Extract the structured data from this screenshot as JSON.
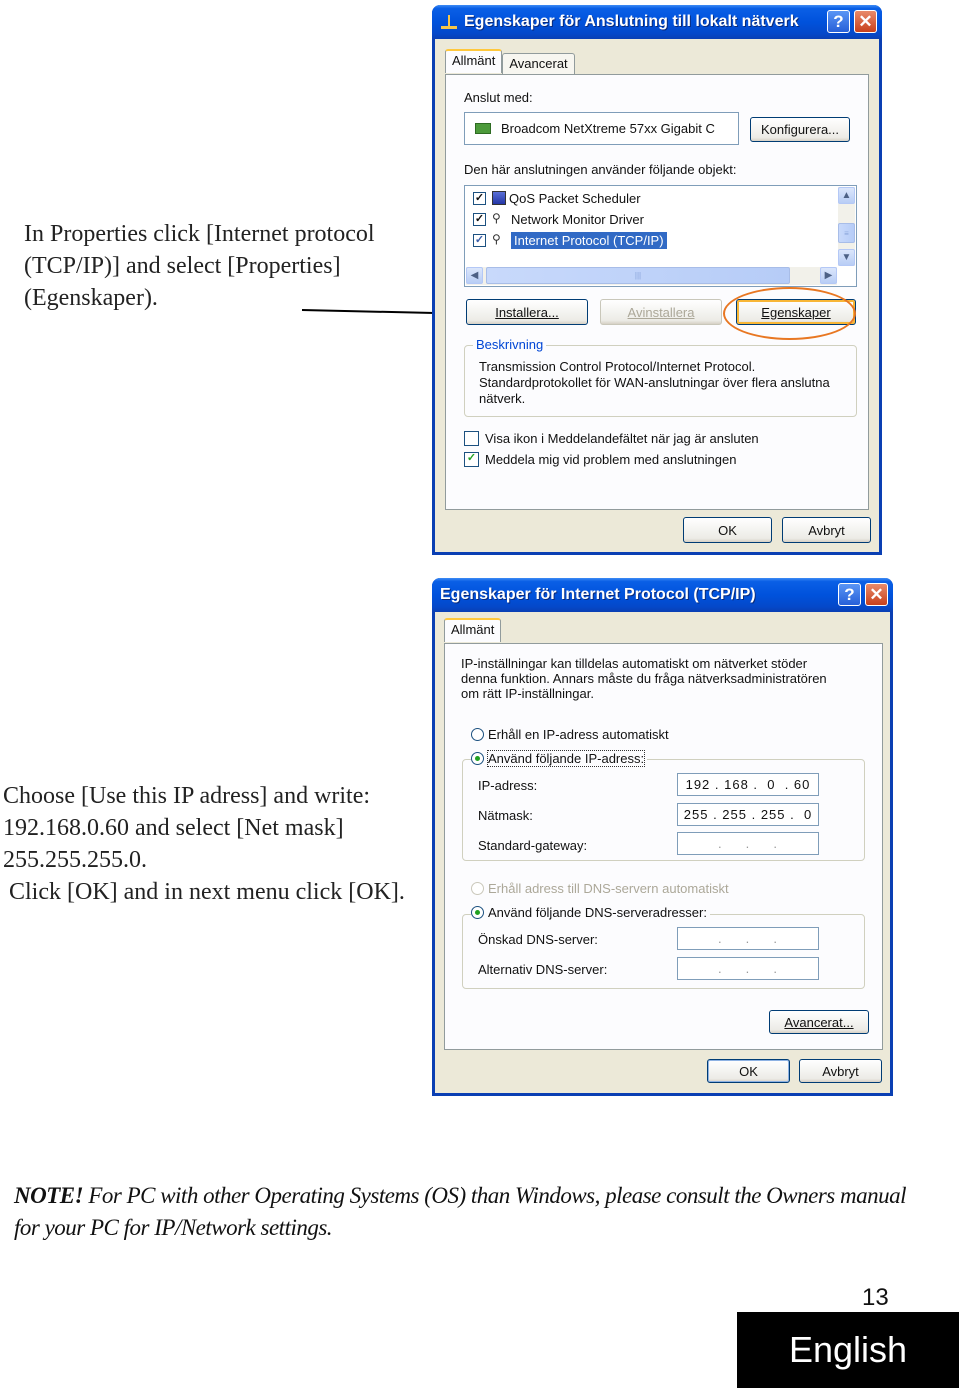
{
  "instructions": {
    "step1": "In Properties click [Internet protocol (TCP/IP)] and select [Properties] (Egenskaper).",
    "step2_line1": "Choose [Use this IP adress] and write: 192.168.0.60 and select [Net mask] 255.255.255.0.",
    "step2_line2": " Click [OK] and in next menu click [OK]."
  },
  "dialog1": {
    "title": "Egenskaper för Anslutning till lokalt nätverk",
    "tabs": [
      "Allmänt",
      "Avancerat"
    ],
    "connect_with_label": "Anslut med:",
    "adapter_name": "Broadcom NetXtreme 57xx Gigabit C",
    "configure_button": "Konfigurera...",
    "components_label": "Den här anslutningen använder följande objekt:",
    "components": [
      {
        "label": "QoS Packet Scheduler",
        "checked": true,
        "icon": "scheduler-icon"
      },
      {
        "label": "Network Monitor Driver",
        "checked": true,
        "icon": "network-protocol-icon"
      },
      {
        "label": "Internet Protocol (TCP/IP)",
        "checked": true,
        "selected": true,
        "icon": "network-protocol-icon"
      }
    ],
    "install_button": "Installera...",
    "uninstall_button": "Avinstallera",
    "properties_button": "Egenskaper",
    "description_group": "Beskrivning",
    "description_text": "Transmission Control Protocol/Internet Protocol. Standardprotokollet för WAN-anslutningar över flera anslutna nätverk.",
    "show_icon_label": "Visa ikon i Meddelandefältet när jag är ansluten",
    "show_icon_checked": false,
    "notify_label": "Meddela mig vid problem med anslutningen",
    "notify_checked": true,
    "ok_button": "OK",
    "cancel_button": "Avbryt"
  },
  "dialog2": {
    "title": "Egenskaper för Internet Protocol (TCP/IP)",
    "tabs": [
      "Allmänt"
    ],
    "intro_text": "IP-inställningar kan tilldelas automatiskt om nätverket stöder denna funktion. Annars måste du fråga nätverksadministratören om rätt IP-inställningar.",
    "auto_ip_label": "Erhåll en IP-adress automatiskt",
    "manual_ip_label": "Använd följande IP-adress:",
    "ip_address_label": "IP-adress:",
    "ip_address_value": "192 . 168 .  0  . 60",
    "netmask_label": "Nätmask:",
    "netmask_value": "255 . 255 . 255 .  0",
    "gateway_label": "Standard-gateway:",
    "gateway_value": "    .     .     .    ",
    "auto_dns_label": "Erhåll adress till DNS-servern automatiskt",
    "manual_dns_label": "Använd följande DNS-serveradresser:",
    "preferred_dns_label": "Önskad DNS-server:",
    "preferred_dns_value": "    .     .     .    ",
    "alternate_dns_label": "Alternativ DNS-server:",
    "alternate_dns_value": "    .     .     .    ",
    "advanced_button": "Avancerat...",
    "ok_button": "OK",
    "cancel_button": "Avbryt"
  },
  "note": {
    "prefix": "NOTE!",
    "text": " For PC with other Operating Systems (OS) than Windows, please consult the Owners manual for your PC for IP/Network settings."
  },
  "footer": {
    "page_number": "13",
    "language": "English"
  },
  "colors": {
    "title_bar": "#0052dc",
    "highlight_ellipse": "#e87722",
    "selection": "#316ac5"
  }
}
